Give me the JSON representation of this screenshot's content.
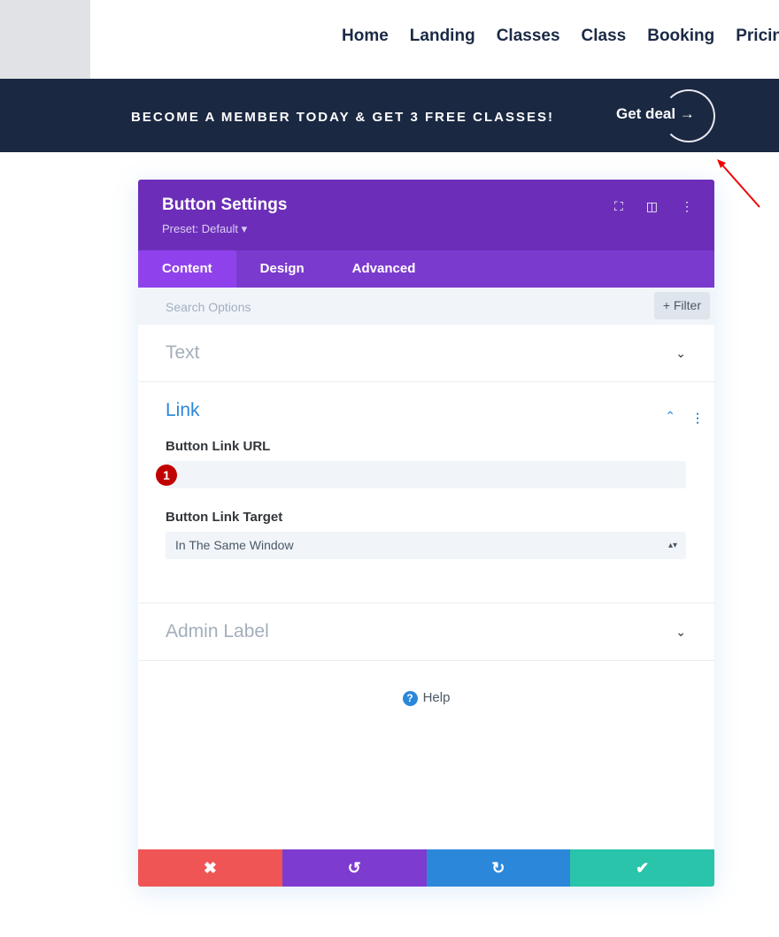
{
  "nav": [
    "Home",
    "Landing",
    "Classes",
    "Class",
    "Booking",
    "Pricing"
  ],
  "banner": {
    "message": "BECOME A MEMBER TODAY & GET 3 FREE CLASSES!",
    "cta": "Get deal →"
  },
  "modal": {
    "title": "Button Settings",
    "preset": "Preset: Default ▾",
    "tabs": [
      "Content",
      "Design",
      "Advanced"
    ],
    "search_placeholder": "Search Options",
    "filter": "+ Filter",
    "sections": {
      "text": "Text",
      "link": "Link",
      "admin": "Admin Label"
    },
    "link_url_label": "Button Link URL",
    "link_url_value": "",
    "step_badge": "1",
    "link_target_label": "Button Link Target",
    "link_target_value": "In The Same Window",
    "help": "Help"
  },
  "colors": {
    "header": "#6c2eb9",
    "tabs": "#7b3ace",
    "cancel": "#ef5555",
    "undo": "#7e3bd0",
    "redo": "#2b87da",
    "save": "#29c4a9",
    "banner": "#1a2842"
  }
}
